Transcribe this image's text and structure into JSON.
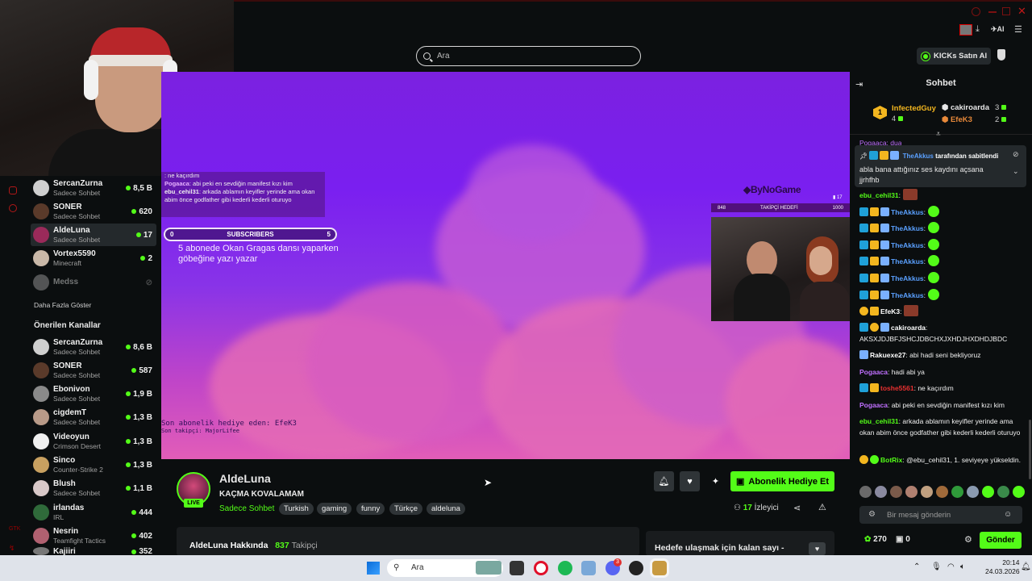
{
  "browser": {
    "search_placeholder": "Ara",
    "kicks_button": "KICKs Satın Al",
    "ai_label": "AI"
  },
  "sidebar": {
    "following": [
      {
        "name": "SercanZurna",
        "category": "Sadece Sohbet",
        "viewers": "8,5 B"
      },
      {
        "name": "SONER",
        "category": "Sadece Sohbet",
        "viewers": "620"
      },
      {
        "name": "AldeLuna",
        "category": "Sadece Sohbet",
        "viewers": "17"
      },
      {
        "name": "Vortex5590",
        "category": "Minecraft",
        "viewers": "2"
      },
      {
        "name": "Medss",
        "category": "",
        "viewers": ""
      }
    ],
    "show_more": "Daha Fazla Göster",
    "recommended_title": "Önerilen Kanallar",
    "recommended": [
      {
        "name": "SercanZurna",
        "category": "Sadece Sohbet",
        "viewers": "8,6 B"
      },
      {
        "name": "SONER",
        "category": "Sadece Sohbet",
        "viewers": "587"
      },
      {
        "name": "Ebonivon",
        "category": "Sadece Sohbet",
        "viewers": "1,9 B"
      },
      {
        "name": "cigdemT",
        "category": "Sadece Sohbet",
        "viewers": "1,3 B"
      },
      {
        "name": "Videoyun",
        "category": "Crimson Desert",
        "viewers": "1,3 B"
      },
      {
        "name": "Sinco",
        "category": "Counter-Strike 2",
        "viewers": "1,3 B"
      },
      {
        "name": "Blush",
        "category": "Sadece Sohbet",
        "viewers": "1,1 B"
      },
      {
        "name": "irlandas",
        "category": "IRL",
        "viewers": "444"
      },
      {
        "name": "Nesrin",
        "category": "Teamfight Tactics",
        "viewers": "402"
      },
      {
        "name": "Kajiiri",
        "category": "",
        "viewers": "352"
      }
    ]
  },
  "video": {
    "overlay_chat": [
      {
        "user": "",
        "text": ": ne kaçırdım"
      },
      {
        "user": "Pogaaca",
        "text": ": abi peki en sevdiğin manifest kızı kim"
      },
      {
        "user": "ebu_cehil31",
        "text": ": arkada ablamın keyifler yerinde ama okan abim önce godfather gibi kederli kederli oturuyo"
      }
    ],
    "subgoal_left": "0",
    "subgoal_label": "SUBSCRIBERS",
    "subgoal_right": "5",
    "subgoal_text": "5 abonede Okan Gragas dansı yaparken göbeğine yazı yazar",
    "brand": "ByNoGame",
    "follow_left": "848",
    "follow_label": "TAKİPÇİ HEDEFİ",
    "follow_right": "1000",
    "follow_small": "17",
    "last_sub_gift": "Son abonelik hediye eden: EfeK3",
    "last_follower": "Son takipçi: MajorLifee"
  },
  "channel": {
    "name": "AldeLuna",
    "title": "KAÇMA KOVALAMAM",
    "category": "Sadece Sohbet",
    "tags": [
      "Turkish",
      "gaming",
      "funny",
      "Türkçe",
      "aldeluna"
    ],
    "live": "LIVE",
    "gift_button": "Abonelik Hediye Et",
    "viewers_count": "17",
    "viewers_label": "İzleyici",
    "about": "AldeLuna Hakkında",
    "followers_count": "837",
    "followers_label": "Takipçi",
    "goal_title": "Hedefe ulaşmak için kalan sayı -"
  },
  "chat": {
    "title": "Sohbet",
    "leaderboard": [
      {
        "name": "InfectedGuy",
        "count": "4"
      },
      {
        "name": "cakiroarda",
        "count": "3"
      },
      {
        "name": "EfeK3",
        "count": "2"
      }
    ],
    "pinned_partial": "Pogaaca: dua",
    "pinned_by_user": "TheAkkus",
    "pinned_by_text": "tarafından sabitlendi",
    "pinned_message": "abla bana attığınız ses kaydını açsana jjrhfhb",
    "messages": [
      {
        "user": "ebu_cehil31",
        "text": ":"
      },
      {
        "user": "TheAkkus",
        "text": ":"
      },
      {
        "user": "TheAkkus",
        "text": ":"
      },
      {
        "user": "TheAkkus",
        "text": ":"
      },
      {
        "user": "TheAkkus",
        "text": ":"
      },
      {
        "user": "TheAkkus",
        "text": ":"
      },
      {
        "user": "TheAkkus",
        "text": ":"
      },
      {
        "user": "EfeK3",
        "text": ":"
      },
      {
        "user": "cakiroarda",
        "text": ":"
      },
      {
        "user": "",
        "text": "AKSXJDJBFJSHCJDBCHXJXHDJHXDHDJBDC"
      },
      {
        "user": "Rakuexe27",
        "text": ": abi hadi seni bekliyoruz"
      },
      {
        "user": "Pogaaca",
        "text": ": hadi abi ya"
      },
      {
        "user": "toshe5561",
        "text": ": ne kaçırdım"
      },
      {
        "user": "Pogaaca",
        "text": ": abi peki en sevdiğin manifest kızı kim"
      },
      {
        "user": "ebu_cehil31",
        "text": ": arkada ablamın keyifler yerinde ama okan abim önce godfather gibi kederli kederli oturuyo"
      },
      {
        "user": "BotRix",
        "text": ": @ebu_cehil31, 1. seviyeye yükseldin."
      }
    ],
    "input_placeholder": "Bir mesaj gönderin",
    "points": "270",
    "other_count": "0",
    "send_button": "Gönder"
  },
  "taskbar": {
    "search": "Ara",
    "time": "20:14",
    "date": "24.03.2026",
    "discord_badge": "3"
  },
  "colors": {
    "accent": "#53fc18",
    "background": "#0b0e0f",
    "panel": "#24292c"
  }
}
